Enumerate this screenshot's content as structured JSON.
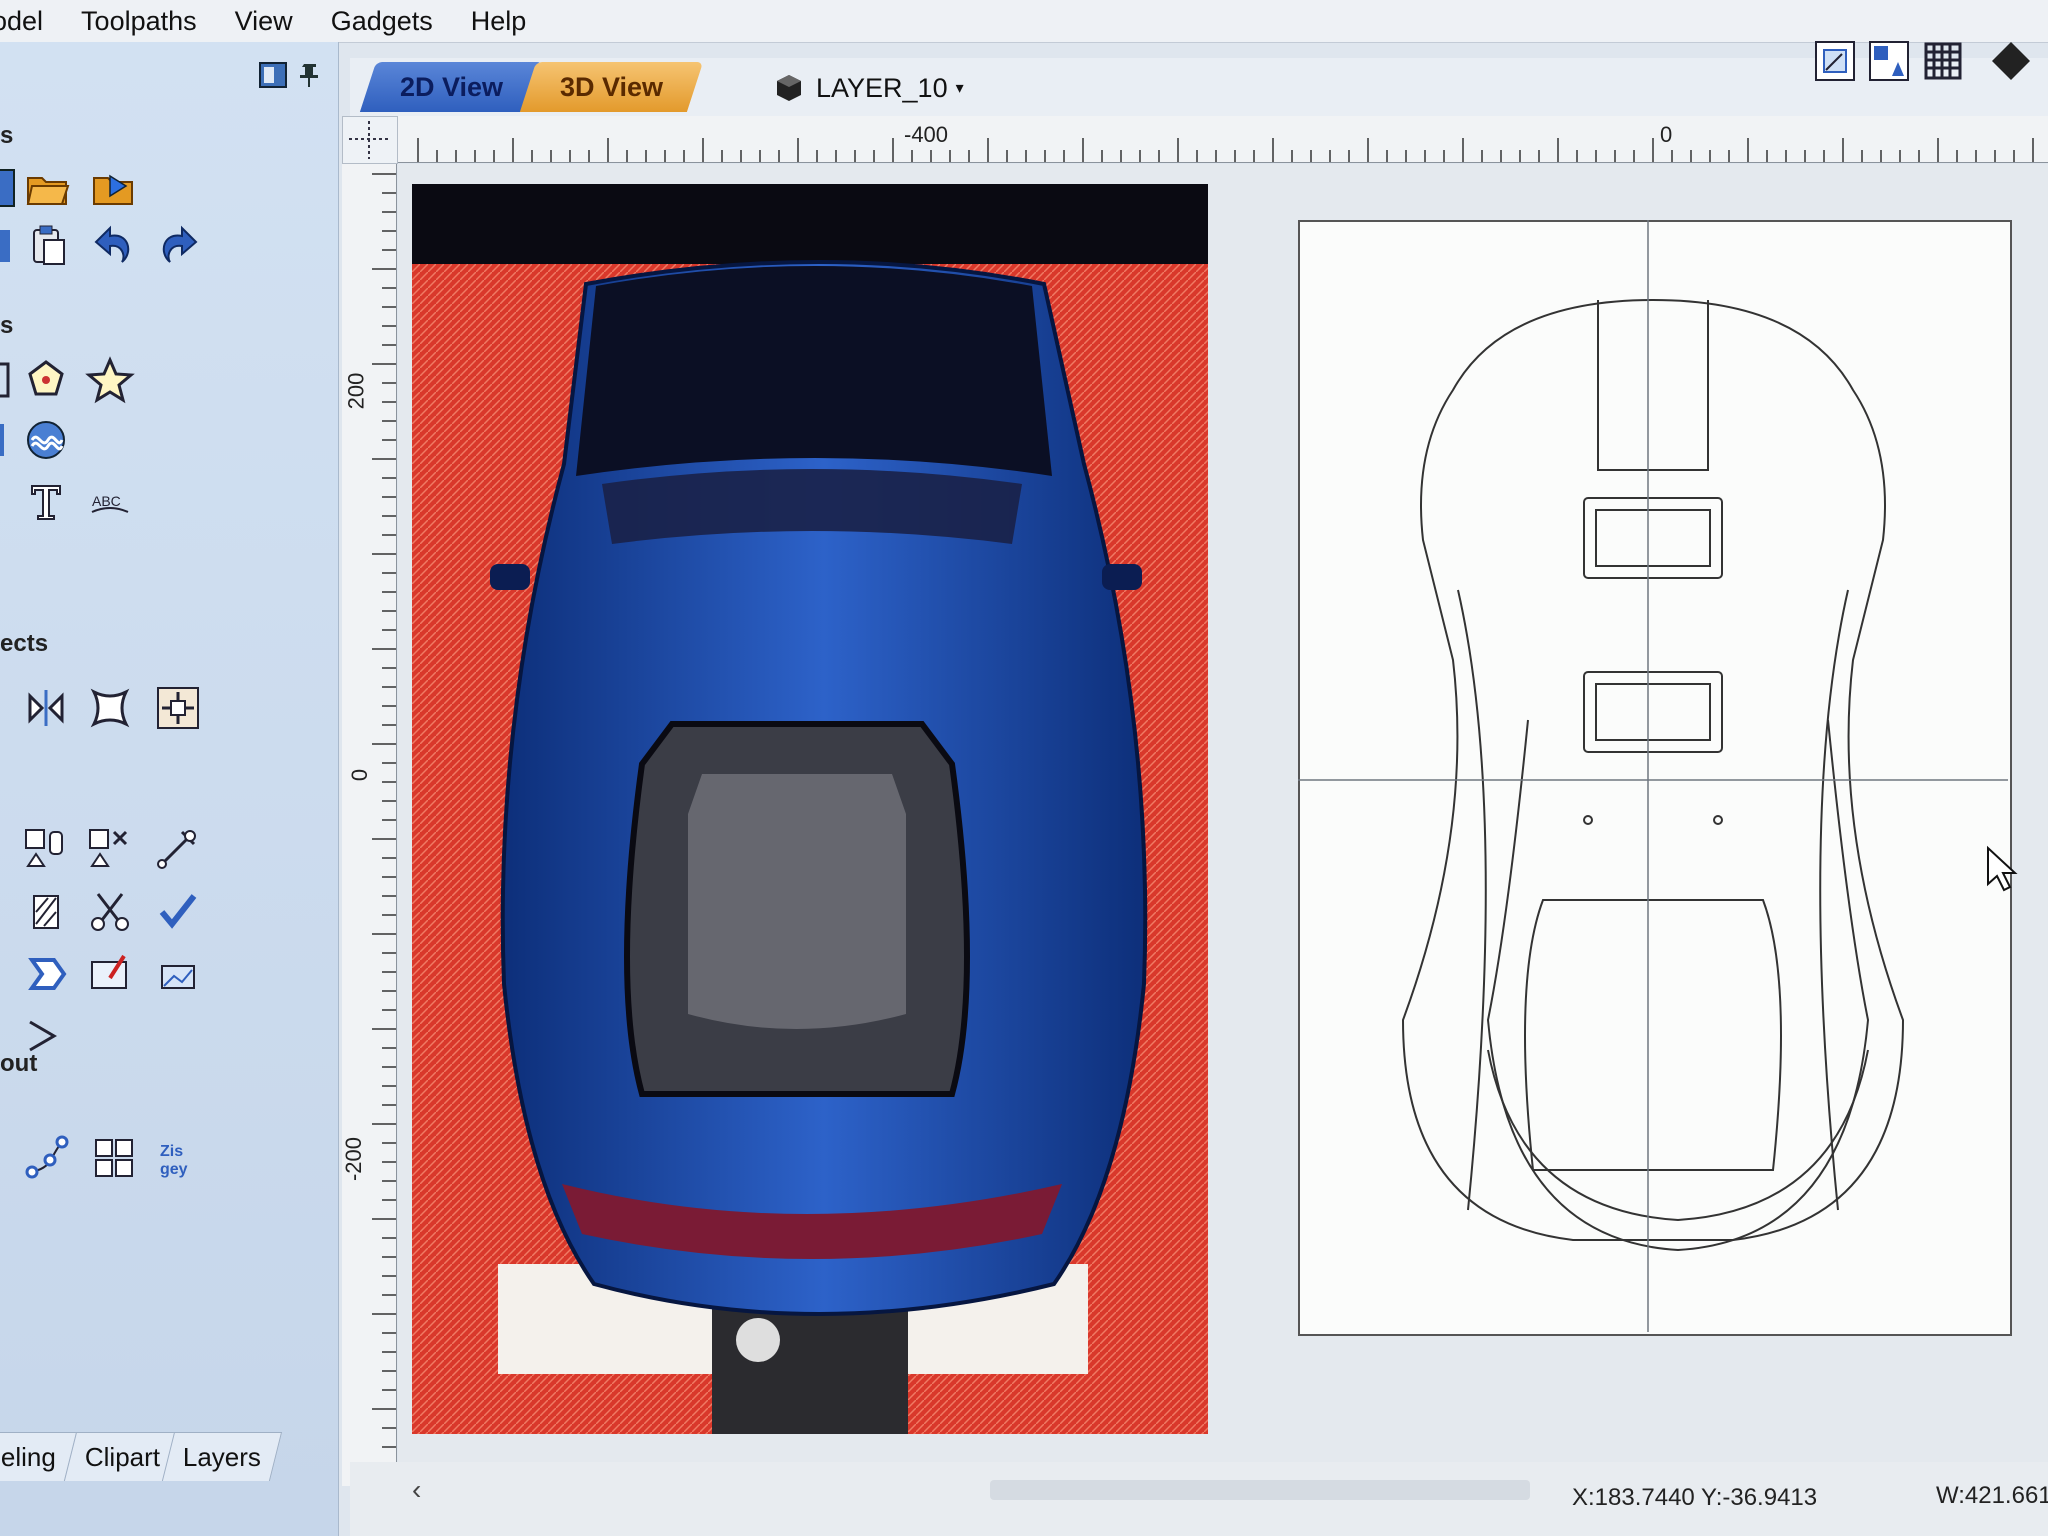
{
  "menu": [
    "odel",
    "Toolpaths",
    "View",
    "Gadgets",
    "Help"
  ],
  "panel": {
    "sections": [
      {
        "key": "s1",
        "label": "s"
      },
      {
        "key": "s2",
        "label": "s"
      },
      {
        "key": "objects",
        "label": "ects"
      },
      {
        "key": "layout",
        "label": "out"
      }
    ],
    "tabs": [
      "eling",
      "Clipart",
      "Layers"
    ]
  },
  "view": {
    "tabs": [
      "2D View",
      "3D View"
    ],
    "active_tab": "2D View",
    "layer": "LAYER_10"
  },
  "ruler": {
    "h_labels": [
      "-400",
      "0"
    ],
    "v_labels": [
      "200",
      "0",
      "-200"
    ]
  },
  "status": {
    "coords": "X:183.7440 Y:-36.9413",
    "width": "W:421.661"
  },
  "colors": {
    "tab_2d": "#2f5fbe",
    "tab_3d": "#e39a2c",
    "photo_background": "#d9382b",
    "car_body": "#1f4fb0",
    "sheet_background": "#fbfcfb"
  }
}
